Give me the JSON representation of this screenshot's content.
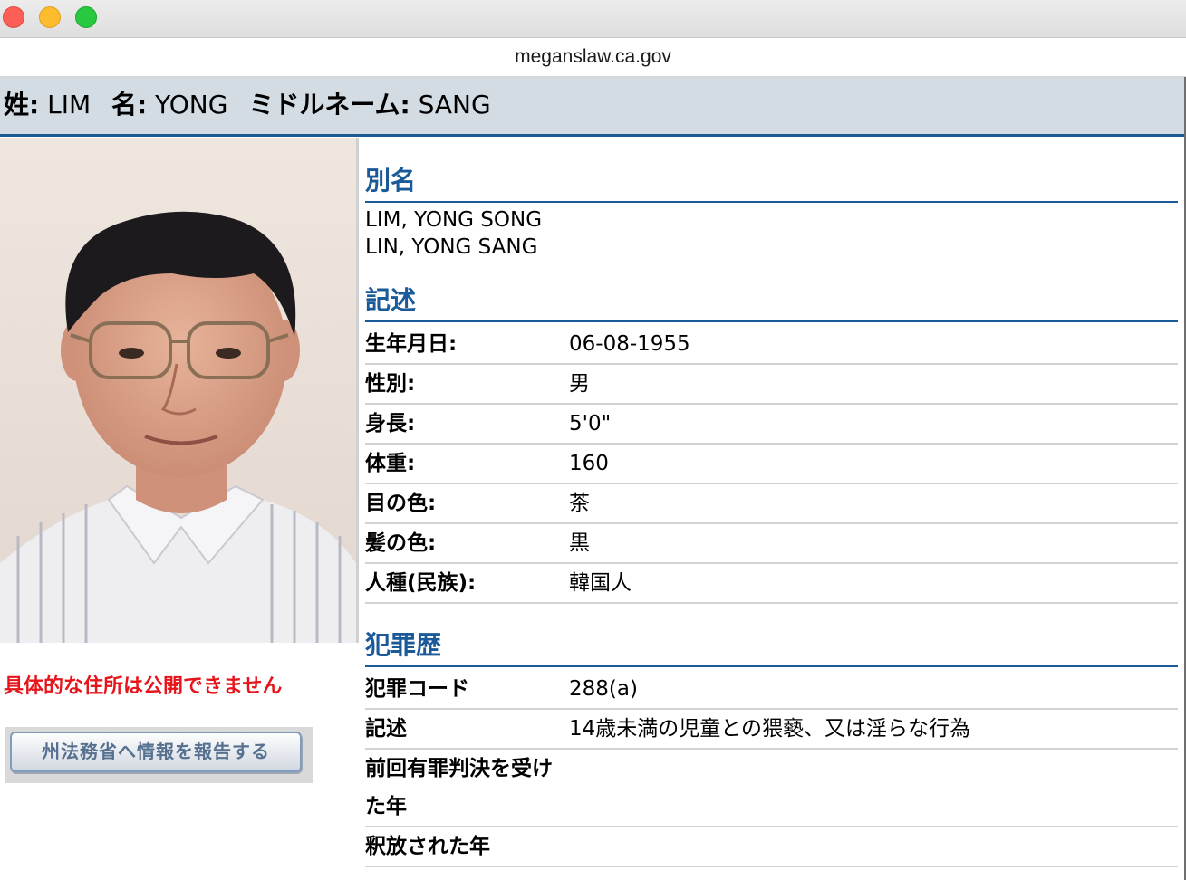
{
  "browser": {
    "url": "meganslaw.ca.gov"
  },
  "header": {
    "last_name_label": "姓:",
    "last_name": "LIM",
    "first_name_label": "名:",
    "first_name": "YONG",
    "middle_name_label": "ミドルネーム:",
    "middle_name": "SANG"
  },
  "photo": {
    "icon": "person-photo"
  },
  "address_notice": "具体的な住所は公開できません",
  "report_button_label": "州法務省へ情報を報告する",
  "aliases": {
    "title": "別名",
    "items": [
      "LIM, YONG SONG",
      "LIN, YONG SANG"
    ]
  },
  "description": {
    "title": "記述",
    "rows": [
      {
        "label": "生年月日:",
        "value": "06-08-1955"
      },
      {
        "label": "性別:",
        "value": "男"
      },
      {
        "label": "身長:",
        "value": "5'0\""
      },
      {
        "label": "体重:",
        "value": "160"
      },
      {
        "label": "目の色:",
        "value": "茶"
      },
      {
        "label": "髪の色:",
        "value": "黒"
      },
      {
        "label": "人種(民族):",
        "value": "韓国人"
      }
    ]
  },
  "offenses": {
    "title": "犯罪歴",
    "rows": [
      {
        "label": "犯罪コード",
        "value": "288(a)"
      },
      {
        "label": "記述",
        "value": "14歳未満の児童との猥褻、又は淫らな行為"
      },
      {
        "label": "前回有罪判決を受けた年",
        "value": ""
      },
      {
        "label": "釈放された年",
        "value": ""
      }
    ]
  },
  "colors": {
    "header_bg": "#d3dbe3",
    "accent_blue": "#1b5a99",
    "notice_red": "#e6151c"
  }
}
